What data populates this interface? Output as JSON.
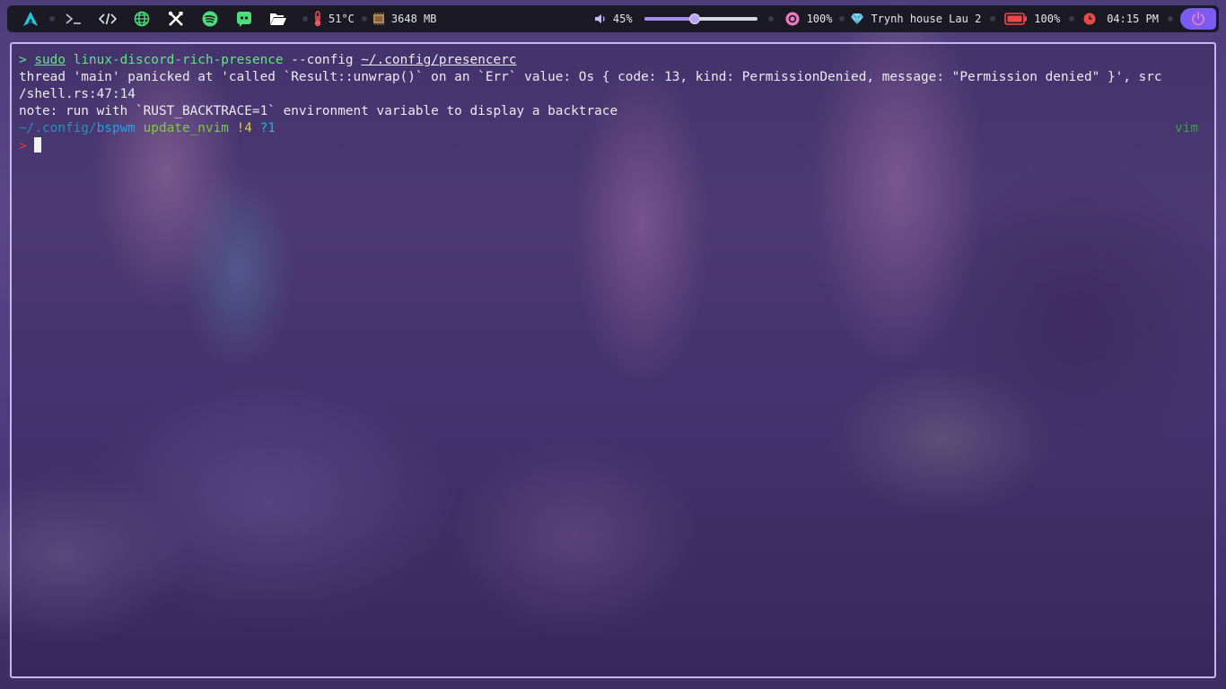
{
  "topbar": {
    "workspaces": [
      {
        "icon": "arch-logo-icon",
        "color": "#1ec8e0"
      },
      {
        "icon": "terminal-icon",
        "color": "#c8c8e6"
      },
      {
        "icon": "code-icon",
        "color": "#e6e6ee"
      },
      {
        "icon": "globe-icon",
        "color": "#4ddc7a"
      },
      {
        "icon": "tools-icon",
        "color": "#ffffff"
      },
      {
        "icon": "spotify-icon",
        "color": "#4ddc7a"
      },
      {
        "icon": "discord-icon",
        "color": "#4ddc7a"
      },
      {
        "icon": "folder-icon",
        "color": "#ffffff"
      }
    ],
    "temperature": "51°C",
    "memory": "3648 MB",
    "volume": "45%",
    "volume_level": 0.45,
    "brightness": "100%",
    "wifi": "Trynh house Lau 2",
    "battery": "100%",
    "time": "04:15 PM",
    "accent": "#7a5cf0"
  },
  "terminal": {
    "line1": {
      "prompt": ">",
      "cmd_sudo": "sudo",
      "cmd_name": "linux-discord-rich-presence",
      "cmd_flag": "--config",
      "cmd_path": "~/.config/presencerc"
    },
    "line2": "thread 'main' panicked at 'called `Result::unwrap()` on an `Err` value: Os { code: 13, kind: PermissionDenied, message: \"Permission denied\" }', src",
    "line3": "/shell.rs:47:14",
    "line4": "note: run with `RUST_BACKTRACE=1` environment variable to display a backtrace",
    "line5": {
      "path_prefix": "~/.config/",
      "path_dir": "bspwm",
      "branch": "update_nvim",
      "modified": "!4",
      "untracked": "?1",
      "right_label": "vim"
    },
    "line6": {
      "prompt": ">"
    }
  }
}
